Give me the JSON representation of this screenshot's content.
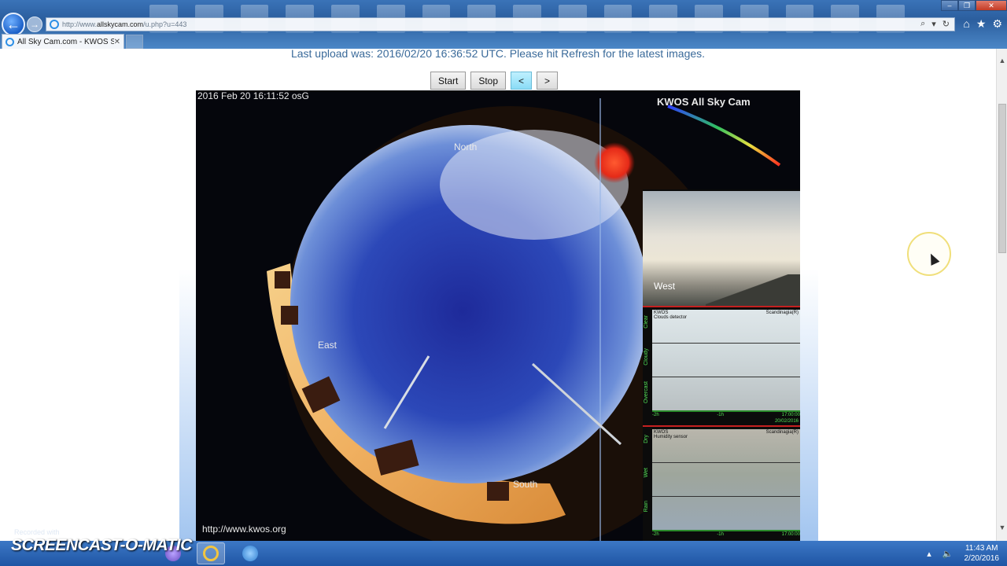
{
  "browser": {
    "url_prefix": "http://www.",
    "url_host": "allskycam.com",
    "url_path": "/u.php?u=443",
    "tab_title": "All Sky Cam.com - KWOS S...",
    "back_icon": "back-arrow-icon",
    "forward_icon": "forward-arrow-icon"
  },
  "page": {
    "upload_message": "Last upload was: 2016/02/20 16:36:52 UTC. Please hit Refresh for the latest images.",
    "buttons": {
      "start": "Start",
      "stop": "Stop",
      "prev": "<",
      "next": ">"
    }
  },
  "skycam": {
    "timestamp": "2016 Feb 20  16:11:52 osG",
    "title": "KWOS All Sky Cam",
    "north": "North",
    "east": "East",
    "south": "South",
    "site_url": "http://www.kwos.org",
    "webcam_label": "West",
    "clouds": {
      "station": "KWOS",
      "sensor": "Clouds detector",
      "brand": "Scandinagia(R)",
      "levels": [
        "Clear",
        "Cloudy",
        "Overcast"
      ],
      "axis": [
        "-2h",
        "-1h",
        "17:00:00"
      ],
      "date": "20/02/2016"
    },
    "humidity": {
      "station": "KWOS",
      "sensor": "Humidity sensor",
      "brand": "Scandinagia(R)",
      "levels": [
        "Dry",
        "Wet",
        "Rain"
      ],
      "axis": [
        "-2h",
        "-1h",
        "17:00:00"
      ]
    }
  },
  "taskbar": {
    "time": "11:43 AM",
    "date": "2/20/2016"
  },
  "watermark": {
    "recorded": "Recorded with",
    "brand": "SCREENCAST-O-MATIC"
  }
}
